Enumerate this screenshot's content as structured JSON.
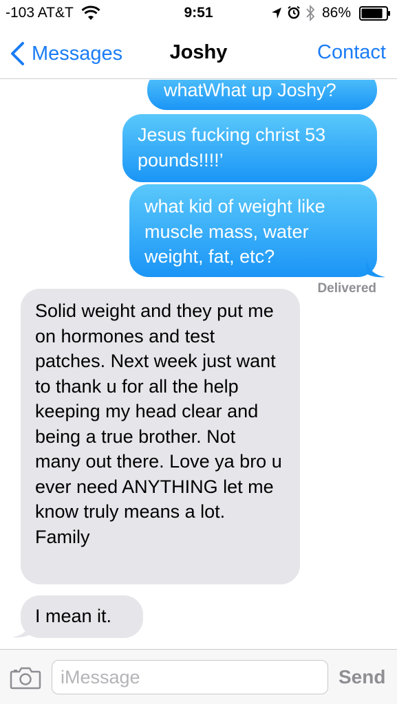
{
  "status_bar": {
    "carrier": "-103 AT&T",
    "time": "9:51",
    "battery_percent": "86%",
    "battery_level": 0.86,
    "icons": [
      "wifi-icon",
      "location-arrow-icon",
      "alarm-clock-icon",
      "bluetooth-icon",
      "battery-icon"
    ]
  },
  "nav": {
    "back_label": "Messages",
    "title": "Joshy",
    "contact_label": "Contact"
  },
  "messages": [
    {
      "direction": "sent",
      "text": "whatWhat up Joshy?"
    },
    {
      "direction": "sent",
      "text": "Jesus fucking christ 53 pounds!!!!’"
    },
    {
      "direction": "sent",
      "text": "what kid of weight like muscle mass, water weight, fat, etc?"
    },
    {
      "direction": "received",
      "text": "Solid weight and they put me on hormones and test patches. Next week just want to thank u for all the help keeping my head clear and being a true brother. Not many out there. Love ya bro u ever need ANYTHING let me know truly means a lot. Family"
    },
    {
      "direction": "received",
      "text": "I mean it."
    }
  ],
  "delivery_status": "Delivered",
  "input": {
    "placeholder": "iMessage",
    "send_label": "Send"
  },
  "colors": {
    "accent": "#1a7cf6",
    "sent_bubble": "#23a3f8",
    "received_bubble": "#e5e5ea",
    "muted_text": "#8e8e93"
  }
}
